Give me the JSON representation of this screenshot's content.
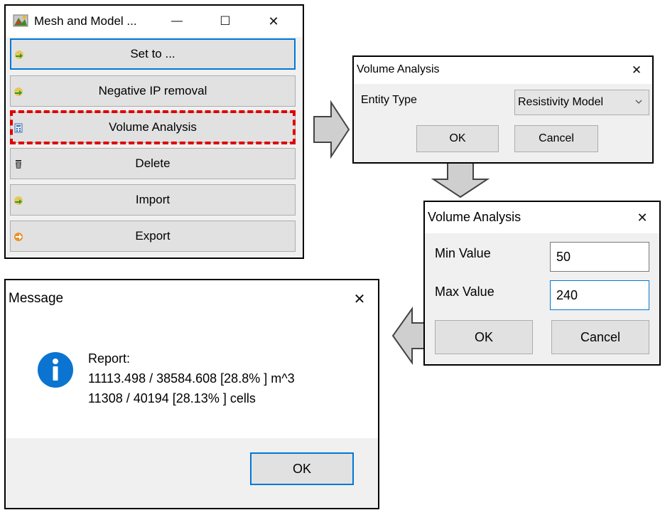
{
  "mesh_window": {
    "title": "Mesh and Model ...",
    "minimize": "—",
    "maximize": "☐",
    "close": "✕",
    "buttons": [
      {
        "label": "Set to ...",
        "icon": "green-arrow-icon"
      },
      {
        "label": "Negative IP removal",
        "icon": "green-arrow-icon"
      },
      {
        "label": "Volume Analysis",
        "icon": "calculator-icon"
      },
      {
        "label": "Delete",
        "icon": "trash-icon"
      },
      {
        "label": "Import",
        "icon": "green-arrow-icon"
      },
      {
        "label": "Export",
        "icon": "orange-export-icon"
      }
    ]
  },
  "entity_dialog": {
    "title": "Volume Analysis",
    "close": "✕",
    "entity_label": "Entity Type",
    "entity_value": "Resistivity Model",
    "ok_label": "OK",
    "cancel_label": "Cancel"
  },
  "range_dialog": {
    "title": "Volume Analysis",
    "close": "✕",
    "min_label": "Min Value",
    "min_value": "50",
    "max_label": "Max Value",
    "max_value": "240",
    "ok_label": "OK",
    "cancel_label": "Cancel"
  },
  "message_dialog": {
    "title": "Message",
    "close": "✕",
    "icon": "info-icon",
    "report_title": "Report:",
    "report_volume": "11113.498 / 38584.608 [28.8% ] m^3",
    "report_cells": "11308 / 40194 [28.13% ] cells",
    "ok_label": "OK"
  },
  "colors": {
    "highlight_dashed": "#e00000",
    "focus_blue": "#0078d7",
    "info_blue": "#0a74d0",
    "button_gray": "#e1e1e1",
    "footer_gray": "#f0f0f0"
  }
}
